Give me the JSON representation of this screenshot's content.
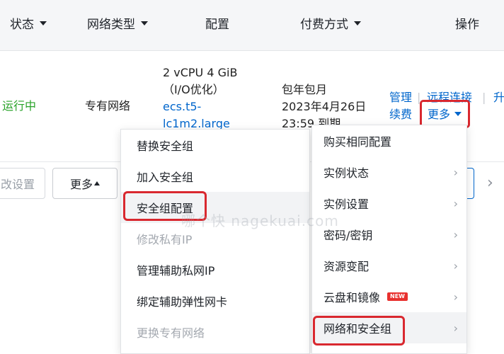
{
  "header": {
    "status": "状态",
    "network_type": "网络类型",
    "config": "配置",
    "billing": "付费方式",
    "actions": "操作"
  },
  "row": {
    "status": "运行中",
    "network": "专有网络",
    "config_line1": "2 vCPU 4 GiB",
    "config_line2": "（I/O优化）",
    "instance_type_line1": "ecs.t5-",
    "instance_type_line2": "lc1m2.large",
    "billing_line1": "包年包月",
    "billing_line2": "2023年4月26日",
    "billing_line3": "23:59 到期",
    "action_manage": "管理",
    "action_remote": "远程连接",
    "action_upgrade": "升",
    "action_renew": "续费",
    "action_more": "更多"
  },
  "toolbar": {
    "partial_settings": "改设置",
    "more": "更多"
  },
  "menu_left": {
    "items": [
      {
        "label": "替换安全组"
      },
      {
        "label": "加入安全组"
      },
      {
        "label": "安全组配置"
      },
      {
        "label": "修改私有IP"
      },
      {
        "label": "管理辅助私网IP"
      },
      {
        "label": "绑定辅助弹性网卡"
      },
      {
        "label": "更换专有网络"
      }
    ]
  },
  "menu_right": {
    "items": [
      {
        "label": "购买相同配置"
      },
      {
        "label": "实例状态"
      },
      {
        "label": "实例设置"
      },
      {
        "label": "密码/密钥"
      },
      {
        "label": "资源变配"
      },
      {
        "label": "云盘和镜像",
        "badge": "NEW"
      },
      {
        "label": "网络和安全组"
      }
    ]
  },
  "watermark": "哪个快 nagekuai.com",
  "colors": {
    "link": "#0066cc",
    "status_running": "#29a329",
    "highlight_red": "#d9282f",
    "badge_new": "#e8302e"
  }
}
